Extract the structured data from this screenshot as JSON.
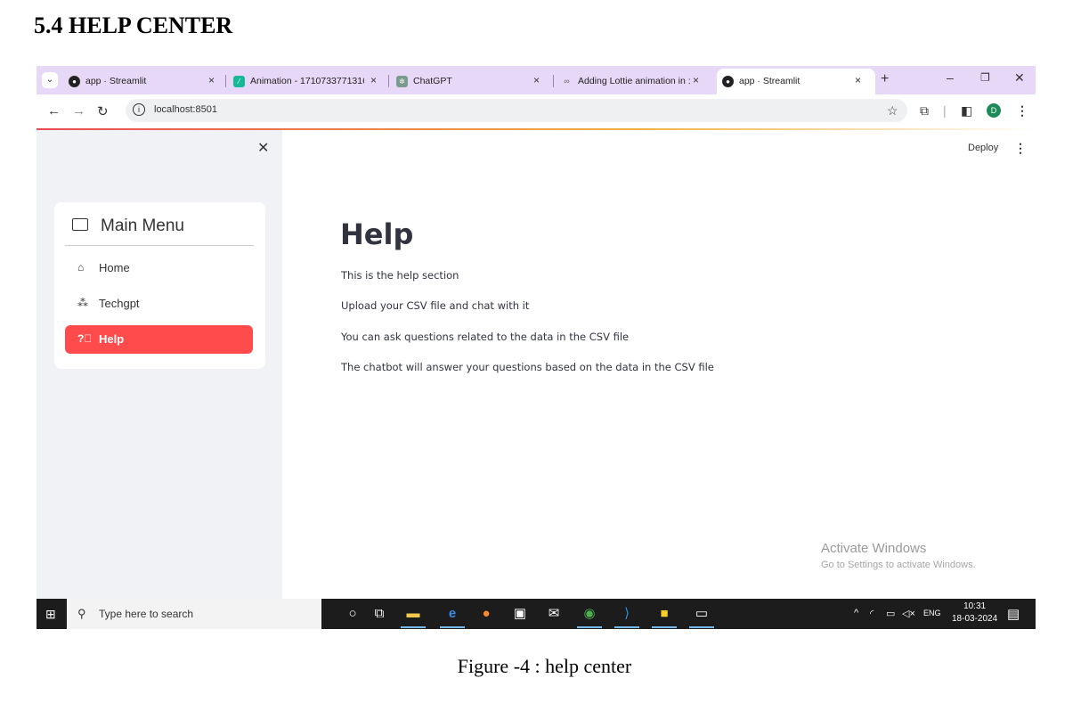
{
  "document": {
    "heading": "5.4 HELP CENTER",
    "caption": "Figure -4 : help center"
  },
  "browser": {
    "tabs": [
      {
        "title": "app · Streamlit",
        "icon": "streamlit-icon",
        "active": false
      },
      {
        "title": "Animation - 1710733771316",
        "icon": "lottie-icon",
        "active": false
      },
      {
        "title": "ChatGPT",
        "icon": "chatgpt-icon",
        "active": false
      },
      {
        "title": "Adding Lottie animation in :",
        "icon": "link-icon",
        "active": false
      },
      {
        "title": "app · Streamlit",
        "icon": "streamlit-icon",
        "active": true
      }
    ],
    "url": "localhost:8501",
    "profile_initial": "D"
  },
  "app": {
    "menu_title": "Main Menu",
    "menu_items": [
      {
        "label": "Home",
        "icon": "house-icon",
        "selected": false
      },
      {
        "label": "Techgpt",
        "icon": "network-icon",
        "selected": false
      },
      {
        "label": "Help",
        "icon": "question-circle-icon",
        "selected": true
      }
    ],
    "deploy_label": "Deploy",
    "page_title": "Help",
    "paragraphs": [
      "This is the help section",
      "Upload your CSV file and chat with it",
      "You can ask questions related to the data in the CSV file",
      "The chatbot will answer your questions based on the data in the CSV file"
    ],
    "accent_color": "#ff4b4b"
  },
  "watermark": {
    "line1": "Activate Windows",
    "line2": "Go to Settings to activate Windows."
  },
  "taskbar": {
    "search_placeholder": "Type here to search",
    "language": "ENG",
    "time": "10:31",
    "date": "18-03-2024"
  }
}
